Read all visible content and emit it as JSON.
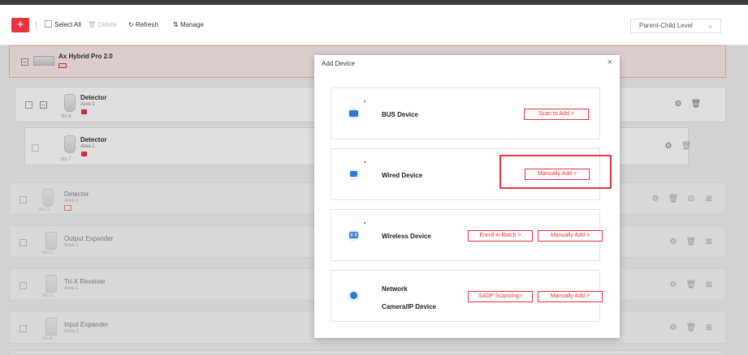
{
  "toolbar": {
    "add_symbol": "+",
    "select_all": "Select All",
    "delete": "Delete",
    "refresh": "Refresh",
    "manage": "Manage",
    "level_select": "Parent-Child Level"
  },
  "panel": {
    "name": "Ax Hybrid Pro 2.0"
  },
  "devices": [
    {
      "name": "Detector",
      "area": "Area 1",
      "no": "No.6"
    },
    {
      "name": "Detector",
      "area": "Area 1",
      "no": "No.7"
    },
    {
      "name": "Detector",
      "area": "Area 1",
      "no": "No.1"
    },
    {
      "name": "Output Expander",
      "area": "Area 1",
      "no": "No.2"
    },
    {
      "name": "Tri-X Receiver",
      "area": "Area 1",
      "no": "No.3"
    },
    {
      "name": "Input Expander",
      "area": "Area 1",
      "no": "No.4"
    }
  ],
  "modal": {
    "title": "Add Device",
    "close": "×",
    "cards": [
      {
        "label": "BUS Device",
        "buttons": [
          "Scan to Add  >"
        ]
      },
      {
        "label": "Wired Device",
        "buttons": [
          "Manually Add  >"
        ]
      },
      {
        "label": "Wireless Device",
        "buttons": [
          "Enroll in Batch  >",
          "Manually Add  >"
        ]
      },
      {
        "label_line1": "Network",
        "label_line2": "Camera/IP Device",
        "buttons": [
          "SADP Scanning>",
          "Manually Add  >"
        ]
      }
    ]
  },
  "icons": {
    "gear": "⚙",
    "trash": "🗑",
    "refresh": "↻",
    "manage": "⇅",
    "chevron": "⌄",
    "expand": "−"
  },
  "colors": {
    "accent": "#e8343a",
    "icon_blue": "#2e7ad1"
  }
}
